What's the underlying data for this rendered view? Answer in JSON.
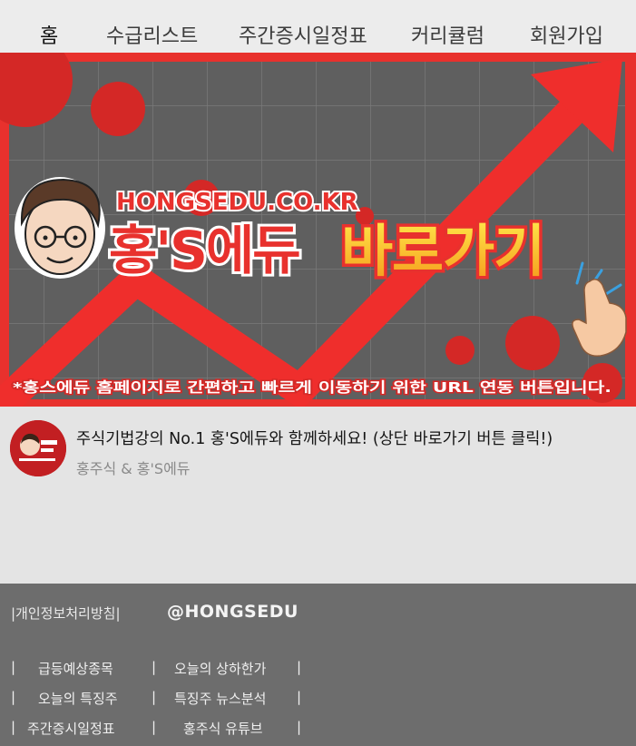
{
  "nav": {
    "items": [
      {
        "label": "홈",
        "active": true
      },
      {
        "label": "수급리스트",
        "active": false
      },
      {
        "label": "주간증시일정표",
        "active": false
      },
      {
        "label": "커리큘럼",
        "active": false
      },
      {
        "label": "회원가입",
        "active": false
      }
    ]
  },
  "banner": {
    "url_text": "HONGSEDU.CO.KR",
    "brand": "홍'S에듀",
    "cta": "바로가기",
    "caption": "*홍스에듀 홈페이지로 간편하고 빠르게 이동하기 위한 URL 연동 버튼입니다."
  },
  "post": {
    "title": "주식기법강의 No.1 홍'S에듀와 함께하세요! (상단 바로가기 버튼 클릭!)",
    "channel": "홍주식 & 홍'S에듀"
  },
  "footer": {
    "privacy": "|개인정보처리방침|",
    "handle": "@HONGSEDU",
    "separator": "|",
    "links": [
      "급등예상종목",
      "오늘의 상하한가",
      "오늘의 특징주",
      "특징주 뉴스분석",
      "주간증시일정표",
      "홍주식 유튜브"
    ]
  },
  "colors": {
    "accent_red": "#e8312d",
    "banner_panel": "#5f5f5f",
    "footer_bg": "#6d6d6d",
    "cta_gradient_top": "#ffe84a",
    "cta_gradient_bottom": "#f59a1b"
  }
}
